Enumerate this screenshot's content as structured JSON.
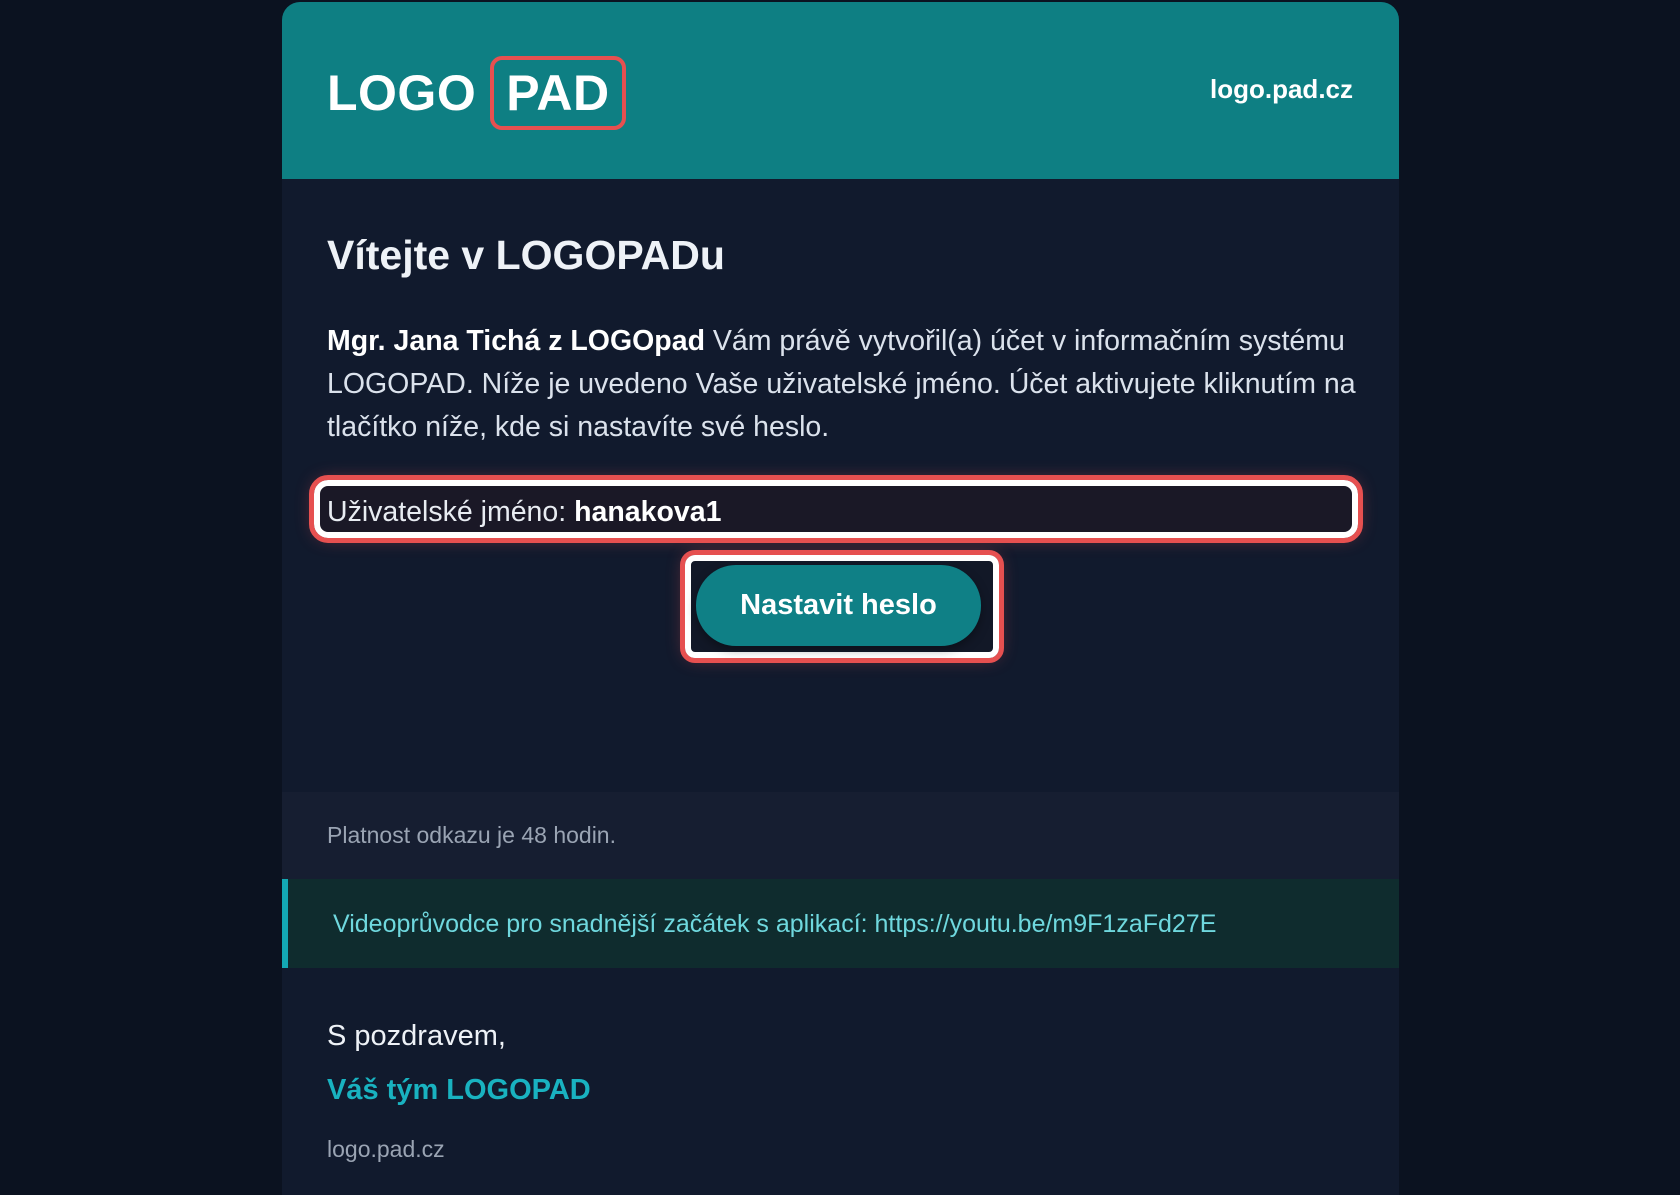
{
  "header": {
    "logo_part1": "LOGO",
    "logo_part2": "PAD",
    "site_link": "logo.pad.cz"
  },
  "main": {
    "title": "Vítejte v LOGOPADu",
    "intro_strong": "Mgr. Jana Tichá z LOGOpad",
    "intro_text": " Vám právě vytvořil(a) účet v informačním systému LOGOPAD. Níže je uvedeno Vaše uživatelské jméno. Účet aktivujete kliknutím na tlačítko níže, kde si nastavíte své heslo.",
    "username_label": "Uživatelské jméno: ",
    "username_value": "hanakova1",
    "button_label": "Nastavit heslo"
  },
  "notice": {
    "validity": "Platnost odkazu je 48 hodin.",
    "video_prefix": "Videoprůvodce pro snadnější začátek s aplikací: ",
    "video_url": "https://youtu.be/m9F1zaFd27E"
  },
  "signature": {
    "greeting": "S pozdravem,",
    "team": "Váš tým LOGOPAD",
    "site": "logo.pad.cz"
  },
  "colors": {
    "accent": "#0e7f83",
    "highlight": "#e65050",
    "link": "#19b2c0",
    "background": "#0b1220"
  }
}
